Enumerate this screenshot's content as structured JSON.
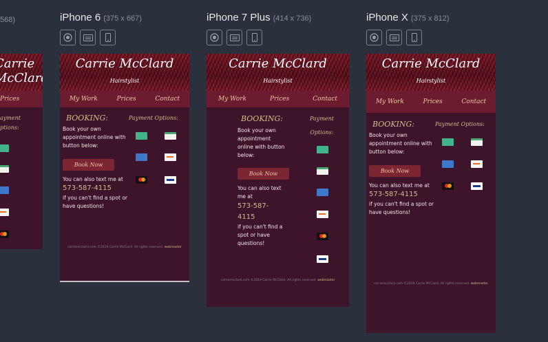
{
  "devices": [
    {
      "id": "partial",
      "dims": "568)",
      "nav": [
        "Prices"
      ],
      "booking_title": "",
      "payment_title": "ayment\nptions:"
    },
    {
      "id": "iphone6",
      "name": "iPhone 6",
      "dims": "(375 x 667)"
    },
    {
      "id": "iphone7plus",
      "name": "iPhone 7 Plus",
      "dims": "(414 x 736)"
    },
    {
      "id": "iphonex",
      "name": "iPhone X",
      "dims": "(375 x 812)"
    }
  ],
  "site": {
    "name": "Carrie McClard",
    "role": "Hairstylist",
    "nav": [
      "My Work",
      "Prices",
      "Contact"
    ],
    "booking_title": "BOOKING:",
    "payment_title": "Payment Options:",
    "payment_title_line1": "Payment",
    "payment_title_line2": "Options:",
    "book_text": "Book your own appointment online with button below:",
    "book_button": "Book Now",
    "text_me": "You can also text me at",
    "phone": "573-587-4115",
    "phone_line1": "573-587-",
    "phone_line2": "4115",
    "spot_text": "if you can't find a spot or have questions!",
    "footer": "carriemcclard.com ©2019 Carrie McClard. All rights reserved.",
    "footer_link": "webmaster"
  },
  "partial_texts": {
    "dims": "568)",
    "name": "Carrie",
    "nav_prices": "Prices",
    "pay1": "ayment",
    "pay2": "ptions:"
  },
  "controls": [
    "target-icon",
    "keyboard-icon",
    "phone-icon"
  ]
}
